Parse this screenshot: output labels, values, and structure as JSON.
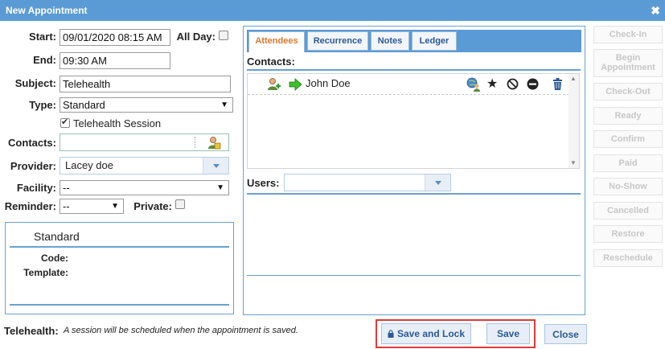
{
  "window": {
    "title": "New Appointment"
  },
  "form": {
    "start_label": "Start:",
    "start_value": "09/01/2020 08:15 AM",
    "allday_label": "All Day:",
    "end_label": "End:",
    "end_value": "09:30 AM",
    "subject_label": "Subject:",
    "subject_value": "Telehealth",
    "type_label": "Type:",
    "type_value": "Standard",
    "telehealth_label": "Telehealth Session",
    "contacts_label": "Contacts:",
    "provider_label": "Provider:",
    "provider_value": "Lacey doe",
    "facility_label": "Facility:",
    "facility_value": "--",
    "reminder_label": "Reminder:",
    "reminder_value": "--",
    "private_label": "Private:"
  },
  "type_panel": {
    "title": "Standard",
    "code_label": "Code:",
    "template_label": "Template:"
  },
  "tabs": [
    {
      "label": "Attendees",
      "active": true
    },
    {
      "label": "Recurrence",
      "active": false
    },
    {
      "label": "Notes",
      "active": false
    },
    {
      "label": "Ledger",
      "active": false
    }
  ],
  "attendees": {
    "contacts_label": "Contacts:",
    "contact_name": "John Doe",
    "users_label": "Users:"
  },
  "side_buttons": {
    "check_in": "Check-In",
    "begin_line1": "Begin",
    "begin_line2": "Appointment",
    "check_out": "Check-Out",
    "ready": "Ready",
    "confirm": "Confirm",
    "paid": "Paid",
    "no_show": "No-Show",
    "cancelled": "Cancelled",
    "restore": "Restore",
    "reschedule": "Reschedule"
  },
  "footer": {
    "telehealth_label": "Telehealth:",
    "telehealth_note": "A session will be scheduled when the appointment is saved.",
    "save_lock": "Save and Lock",
    "save": "Save",
    "close": "Close"
  },
  "colors": {
    "title_bar": "#5b9bd5",
    "highlight_box": "#e03a3a",
    "active_tab": "#d9782d"
  }
}
